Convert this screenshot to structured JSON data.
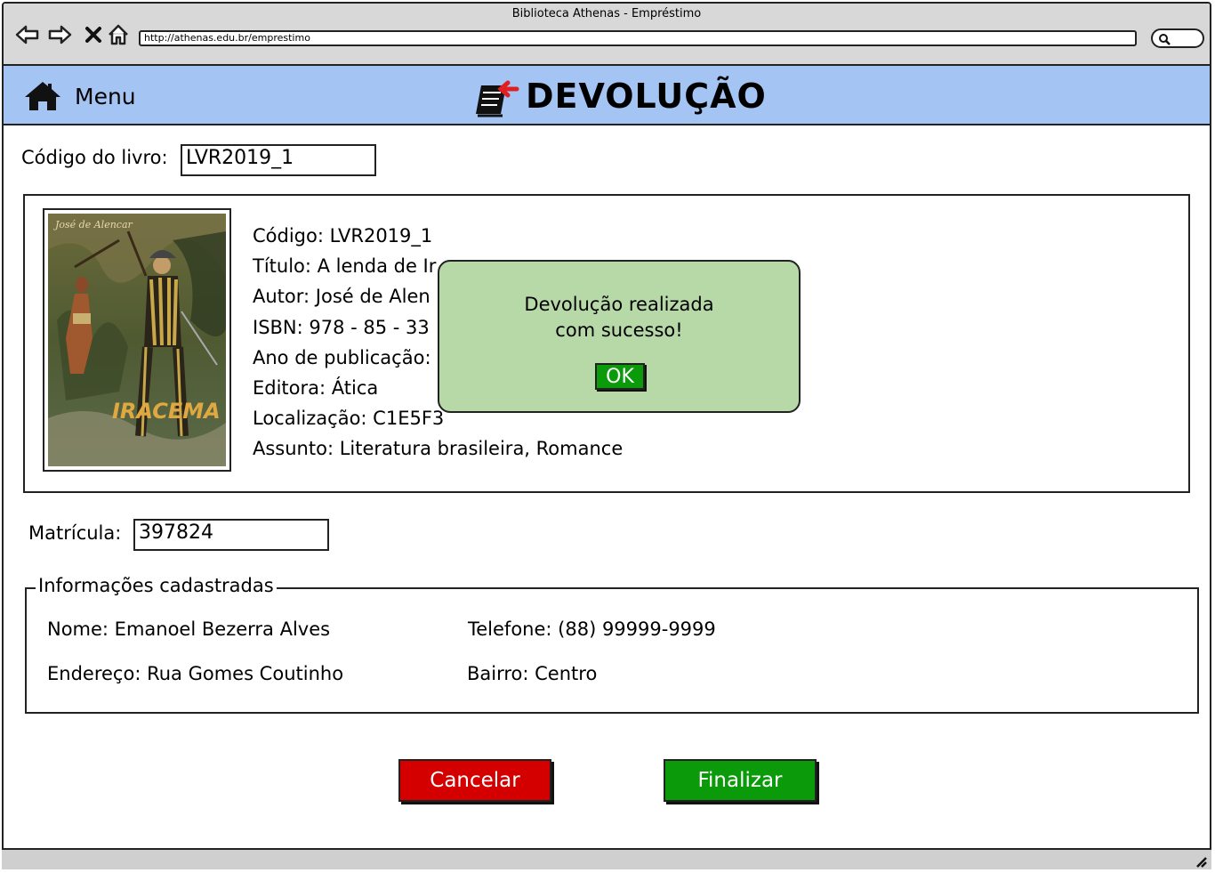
{
  "window": {
    "title": "Biblioteca Athenas - Empréstimo",
    "url": "http://athenas.edu.br/emprestimo"
  },
  "header": {
    "menu_label": "Menu",
    "title": "DEVOLUÇÃO"
  },
  "form": {
    "book_code_label": "Código do livro:",
    "book_code_value": "LVR2019_1",
    "registration_label": "Matrícula:",
    "registration_value": "397824"
  },
  "book": {
    "cover_author": "José de Alencar",
    "cover_title": "IRACEMA",
    "details": [
      "Código: LVR2019_1",
      "Título: A lenda de Ir",
      "Autor: José de Alen",
      "ISBN: 978 - 85 - 33",
      "Ano de publicação:",
      "Editora: Ática",
      "Localização: C1E5F3",
      "Assunto: Literatura brasileira, Romance"
    ]
  },
  "user_info": {
    "legend": "Informações cadastradas",
    "name": "Nome: Emanoel Bezerra Alves",
    "phone": "Telefone: (88) 99999-9999",
    "address": "Endereço: Rua Gomes Coutinho",
    "district": "Bairro: Centro"
  },
  "buttons": {
    "cancel": "Cancelar",
    "finish": "Finalizar"
  },
  "dialog": {
    "line1": "Devolução realizada",
    "line2": "com sucesso!",
    "ok": "OK"
  },
  "colors": {
    "header_bg": "#a4c4f4",
    "cancel": "#d40000",
    "finish": "#0a9a0a",
    "dialog_bg": "#b7d9a8",
    "accent_red": "#e02020"
  }
}
